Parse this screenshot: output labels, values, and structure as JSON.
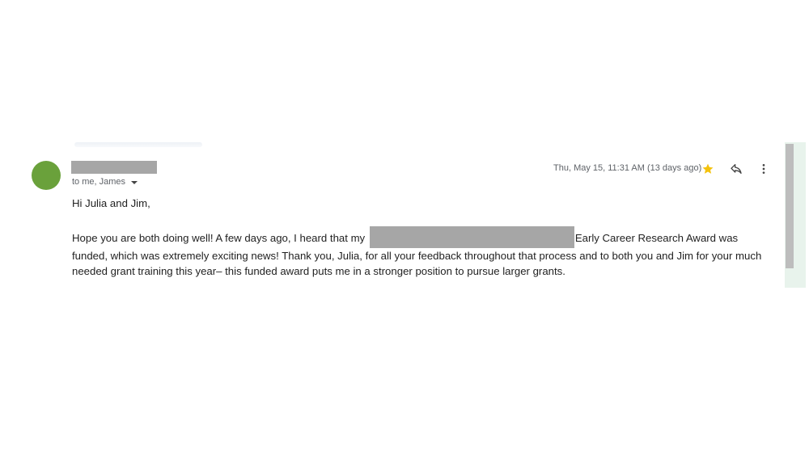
{
  "email": {
    "recipients_label": "to me, James",
    "timestamp": "Thu, May 15, 11:31 AM (13 days ago)",
    "greeting": "Hi Julia and Jim,",
    "paragraph_before_redaction": "Hope you are both doing well! A few days ago, I heard that my ",
    "paragraph_after_redaction": "Early Career Research Award was funded, which was extremely exciting news! Thank you, Julia, for all your feedback throughout that process and to both you and Jim for your much needed grant training this year– this funded award puts me in a stronger position to pursue larger grants."
  },
  "icons": {
    "star": "star-icon",
    "reply": "reply-icon",
    "more": "more-vert-icon",
    "caret": "chevron-down-icon"
  },
  "colors": {
    "avatar": "#6aa13b",
    "redaction": "#a6a6a6",
    "star": "#f4c20d",
    "scrollbar_track": "#e8f3ec",
    "scrollbar_thumb": "#bdbdbd"
  }
}
